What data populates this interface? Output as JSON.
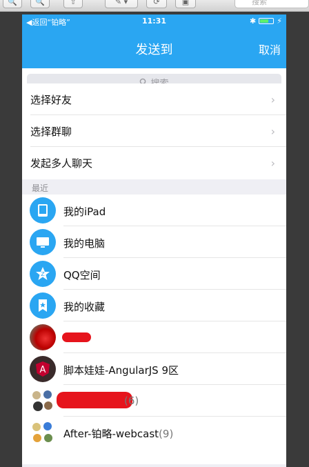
{
  "toolbar": {
    "search_placeholder": "搜索"
  },
  "status": {
    "back": "◀返回“铂略”",
    "time": "11:31",
    "bt_icon": "bluetooth-icon"
  },
  "nav": {
    "title": "发送到",
    "cancel": "取消"
  },
  "search": {
    "placeholder": "搜索"
  },
  "menu": [
    {
      "label": "选择好友"
    },
    {
      "label": "选择群聊"
    },
    {
      "label": "发起多人聊天"
    }
  ],
  "recent_header": "最近",
  "recent": [
    {
      "label": "我的iPad",
      "icon": "ipad-icon"
    },
    {
      "label": "我的电脑",
      "icon": "computer-icon"
    },
    {
      "label": "QQ空间",
      "icon": "qzone-star-icon"
    },
    {
      "label": "我的收藏",
      "icon": "favorites-icon"
    },
    {
      "label": "",
      "icon": "avatar-photo"
    },
    {
      "label": "脚本娃娃-AngularJS 9区",
      "icon": "avatar-angular"
    },
    {
      "label": "",
      "count": "(6)",
      "icon": "group-avatar"
    },
    {
      "label": "After-铂略-webcast",
      "count": "(9)",
      "icon": "group-avatar"
    }
  ],
  "colors": {
    "accent": "#2aa6f2",
    "redaction": "#e6141c"
  }
}
